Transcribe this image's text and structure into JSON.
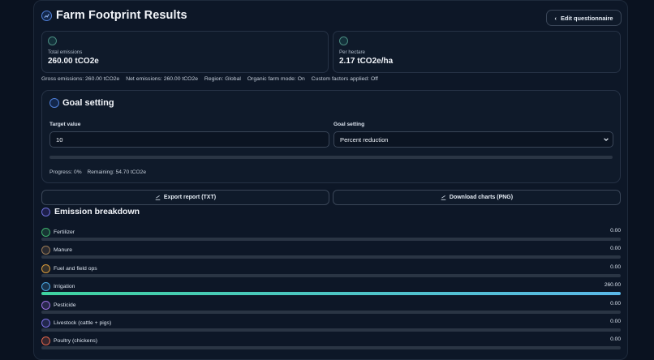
{
  "header": {
    "title": "Farm Footprint Results",
    "edit_button": "Edit questionnaire"
  },
  "cards": {
    "total": {
      "label": "Total emissions",
      "value": "260.00 tCO2e"
    },
    "per_hectare": {
      "label": "Per hectare",
      "value": "2.17 tCO2e/ha"
    }
  },
  "meta": {
    "gross": "Gross emissions: 260.00 tCO2e",
    "net": "Net emissions: 260.00 tCO2e",
    "region": "Region: Global",
    "organic": "Organic farm mode: On",
    "custom": "Custom factors applied: Off"
  },
  "goal": {
    "title": "Goal setting",
    "target_label": "Target value",
    "target_value": "10",
    "mode_label": "Goal setting",
    "mode_value": "Percent reduction",
    "progress_fraction": 0,
    "progress_text": "Progress: 0%",
    "remaining_text": "Remaining: 54.70 tCO2e"
  },
  "actions": {
    "export": "Export report (TXT)",
    "download": "Download charts (PNG)"
  },
  "breakdown": {
    "title": "Emission breakdown",
    "max_value": 260,
    "items": [
      {
        "label": "Fertilizer",
        "value": "0.00",
        "amount": 0,
        "icon": "leaf-icon",
        "color": "#3fae6b"
      },
      {
        "label": "Manure",
        "value": "0.00",
        "amount": 0,
        "icon": "manure-icon",
        "color": "#9a7a55"
      },
      {
        "label": "Fuel and field ops",
        "value": "0.00",
        "amount": 0,
        "icon": "fuel-icon",
        "color": "#d79a3b"
      },
      {
        "label": "Irrigation",
        "value": "260.00",
        "amount": 260,
        "icon": "water-drop-icon",
        "color": "#4aa6e0"
      },
      {
        "label": "Pesticide",
        "value": "0.00",
        "amount": 0,
        "icon": "spray-icon",
        "color": "#9b6fe0"
      },
      {
        "label": "Livestock (cattle + pigs)",
        "value": "0.00",
        "amount": 0,
        "icon": "cow-icon",
        "color": "#7a6fe0"
      },
      {
        "label": "Poultry (chickens)",
        "value": "0.00",
        "amount": 0,
        "icon": "chicken-icon",
        "color": "#e0654a"
      }
    ]
  }
}
